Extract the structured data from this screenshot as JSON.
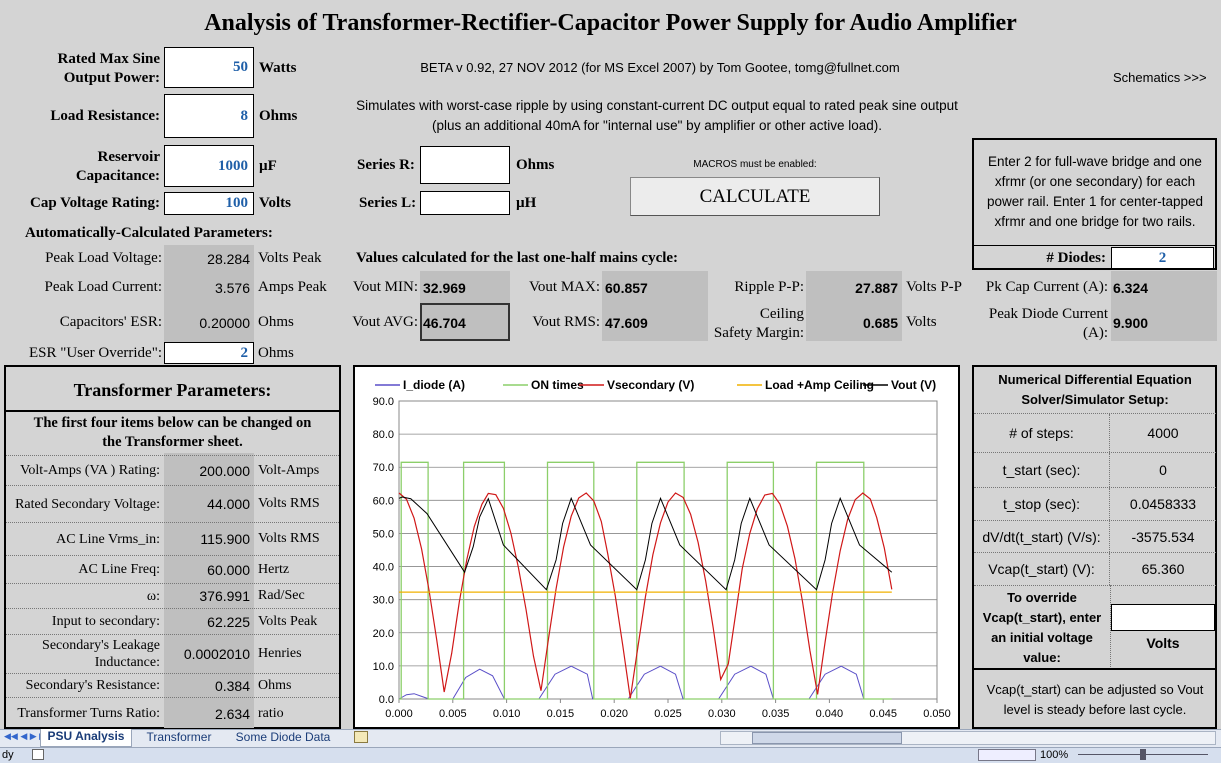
{
  "title": "Analysis of Transformer-Rectifier-Capacitor Power Supply for Audio Amplifier",
  "version": "BETA v 0.92, 27 NOV 2012 (for MS Excel 2007) by Tom Gootee, tomg@fullnet.com",
  "schematics_link": "Schematics >>>",
  "description_line1": "Simulates with worst-case ripple by using constant-current DC output equal to rated peak sine output",
  "description_line2": "(plus an additional 40mA for \"internal use\" by amplifier or other active load).",
  "macros_note": "MACROS must be enabled:",
  "calculate_label": "CALCULATE",
  "inputs": {
    "rated_power_label_1": "Rated Max Sine",
    "rated_power_label_2": "Output Power:",
    "rated_power": "50",
    "rated_power_unit": "Watts",
    "load_resistance_label": "Load Resistance:",
    "load_resistance": "8",
    "load_resistance_unit": "Ohms",
    "reservoir_label_1": "Reservoir",
    "reservoir_label_2": "Capacitance:",
    "reservoir": "1000",
    "reservoir_unit": "µF",
    "cap_voltage_label": "Cap Voltage Rating:",
    "cap_voltage": "100",
    "cap_voltage_unit": "Volts",
    "series_r_label": "Series R:",
    "series_r": "",
    "series_r_unit": "Ohms",
    "series_l_label": "Series L:",
    "series_l": "",
    "series_l_unit": "µH"
  },
  "auto": {
    "heading": "Automatically-Calculated Parameters:",
    "peak_load_voltage_label": "Peak Load Voltage:",
    "peak_load_voltage": "28.284",
    "peak_load_voltage_unit": "Volts Peak",
    "peak_load_current_label": "Peak Load Current:",
    "peak_load_current": "3.576",
    "peak_load_current_unit": "Amps Peak",
    "esr_label": "Capacitors' ESR:",
    "esr": "0.20000",
    "esr_unit": "Ohms",
    "esr_override_label": "ESR \"User Override\":",
    "esr_override": "2",
    "esr_override_unit": "Ohms"
  },
  "cycle": {
    "heading": "Values calculated for the last one-half mains cycle:",
    "vout_min_label": "Vout MIN:",
    "vout_min": "32.969",
    "vout_max_label": "Vout MAX:",
    "vout_max": "60.857",
    "ripple_label": "Ripple P-P:",
    "ripple": "27.887",
    "ripple_unit": "Volts P-P",
    "vout_avg_label": "Vout AVG:",
    "vout_avg": "46.704",
    "vout_rms_label": "Vout RMS:",
    "vout_rms": "47.609",
    "ceiling_label_1": "Ceiling",
    "ceiling_label_2": "Safety Margin:",
    "ceiling": "0.685",
    "ceiling_unit": "Volts",
    "pk_cap_label": "Pk Cap Current (A):",
    "pk_cap": "6.324",
    "peak_diode_label_1": "Peak Diode Current",
    "peak_diode_label_2": "(A):",
    "peak_diode": "9.900"
  },
  "diodes": {
    "note_1": "Enter 2 for full-wave bridge and one",
    "note_2": "xfrmr (or one secondary) for each",
    "note_3": "power rail. Enter 1 for center-tapped",
    "note_4": "xfrmr and one bridge for two rails.",
    "label": "# Diodes:",
    "value": "2"
  },
  "transformer": {
    "heading": "Transformer Parameters:",
    "note_1": "The first four items below can be changed  on",
    "note_2": "the Transformer sheet.",
    "rows": [
      {
        "label": "Volt-Amps (VA ) Rating:",
        "value": "200.000",
        "unit": "Volt-Amps"
      },
      {
        "label": "Rated Secondary Voltage:",
        "value": "44.000",
        "unit": "Volts RMS"
      },
      {
        "label": "AC Line Vrms_in:",
        "value": "115.900",
        "unit": "Volts RMS"
      },
      {
        "label": "AC Line Freq:",
        "value": "60.000",
        "unit": "Hertz"
      },
      {
        "label": "ω:",
        "value": "376.991",
        "unit": "Rad/Sec"
      },
      {
        "label": "Input to secondary:",
        "value": "62.225",
        "unit": "Volts Peak"
      },
      {
        "label": "Secondary's Leakage Inductance:",
        "value": "0.0002010",
        "unit": "Henries"
      },
      {
        "label": "Secondary's Resistance:",
        "value": "0.384",
        "unit": "Ohms"
      },
      {
        "label": "Transformer Turns Ratio:",
        "value": "2.634",
        "unit": "ratio"
      }
    ]
  },
  "solver": {
    "heading_1": "Numerical Differential Equation",
    "heading_2": "Solver/Simulator Setup:",
    "rows": [
      {
        "label": "# of steps:",
        "value": "4000"
      },
      {
        "label": "t_start (sec):",
        "value": "0"
      },
      {
        "label": "t_stop (sec):",
        "value": "0.0458333"
      },
      {
        "label": "dV/dt(t_start) (V/s):",
        "value": "-3575.534"
      },
      {
        "label": "Vcap(t_start) (V):",
        "value": "65.360"
      }
    ],
    "override_1": "To override",
    "override_2": "Vcap(t_start), enter",
    "override_3": "an initial voltage",
    "override_4": "value:",
    "override_value": "",
    "override_unit": "Volts",
    "note_1": "Vcap(t_start) can be adjusted so Vout",
    "note_2": "level is steady before last cycle."
  },
  "tabs": [
    "PSU Analysis",
    "Transformer",
    "Some Diode Data"
  ],
  "status": {
    "ready": "dy",
    "zoom": "100%"
  },
  "colors": {
    "i_diode": "#5a4fc8",
    "on_times": "#8ccf6a",
    "vsecondary": "#d01818",
    "ceiling": "#f0b000",
    "vout": "#000000",
    "input_text": "#1f5fa8"
  },
  "chart_data": {
    "type": "line",
    "xlim": [
      0,
      0.05
    ],
    "ylim": [
      0,
      90
    ],
    "x_ticks": [
      "0.000",
      "0.005",
      "0.010",
      "0.015",
      "0.020",
      "0.025",
      "0.030",
      "0.035",
      "0.040",
      "0.045",
      "0.050"
    ],
    "y_ticks": [
      "0.0",
      "10.0",
      "20.0",
      "30.0",
      "40.0",
      "50.0",
      "60.0",
      "70.0",
      "80.0",
      "90.0"
    ],
    "grid": true,
    "legend": "top",
    "series": [
      {
        "name": "I_diode (A)",
        "x": [
          0,
          0.0007,
          0.0014,
          0.0021,
          0.0028,
          0.0035,
          0.0042,
          0.005,
          0.0062,
          0.0075,
          0.0087,
          0.0098,
          0.0104,
          0.013,
          0.0145,
          0.016,
          0.0175,
          0.018,
          0.0213,
          0.0228,
          0.0243,
          0.0257,
          0.0264,
          0.0297,
          0.0312,
          0.0327,
          0.0341,
          0.0348,
          0.0381,
          0.0396,
          0.0411,
          0.0425,
          0.0432
        ],
        "y": [
          0,
          1.3,
          1.6,
          0.8,
          0,
          0,
          0,
          0,
          6.5,
          9,
          7,
          0,
          0,
          0,
          7.5,
          9.9,
          7.5,
          0,
          0,
          7.5,
          9.9,
          7.5,
          0,
          0,
          7.5,
          9.9,
          7.5,
          0,
          0,
          7.5,
          9.9,
          7.5,
          0
        ]
      },
      {
        "name": "ON times",
        "x": [
          0,
          0.0002,
          0.0002,
          0.0027,
          0.0027,
          0.006,
          0.006,
          0.0098,
          0.0098,
          0.0138,
          0.0138,
          0.0181,
          0.0181,
          0.0221,
          0.0221,
          0.0265,
          0.0265,
          0.0305,
          0.0305,
          0.0348,
          0.0348,
          0.0388,
          0.0388,
          0.0432,
          0.0432,
          0.0458
        ],
        "y": [
          0,
          0,
          71.5,
          71.5,
          0,
          0,
          71.5,
          71.5,
          0,
          0,
          71.5,
          71.5,
          0,
          0,
          71.5,
          71.5,
          0,
          0,
          71.5,
          71.5,
          0,
          0,
          71.5,
          71.5,
          0,
          0
        ]
      },
      {
        "name": "Vsecondary (V)",
        "x": [
          0,
          0.0007,
          0.0014,
          0.0021,
          0.0028,
          0.0035,
          0.0042,
          0.0049,
          0.0056,
          0.0063,
          0.007,
          0.0077,
          0.0083,
          0.009,
          0.0097,
          0.0104,
          0.0111,
          0.0118,
          0.0125,
          0.0132,
          0.0139,
          0.0146,
          0.0153,
          0.016,
          0.0167,
          0.0174,
          0.0181,
          0.0188,
          0.0194,
          0.0201,
          0.0208,
          0.0215,
          0.0222,
          0.0229,
          0.0236,
          0.0243,
          0.025,
          0.0257,
          0.0264,
          0.0271,
          0.0278,
          0.0285,
          0.0292,
          0.0299,
          0.0306,
          0.0313,
          0.0319,
          0.0326,
          0.0333,
          0.034,
          0.0347,
          0.0354,
          0.0361,
          0.0368,
          0.0375,
          0.0382,
          0.0389,
          0.0396,
          0.0403,
          0.041,
          0.0417,
          0.0424,
          0.0431,
          0.0438,
          0.0444,
          0.0451,
          0.0458
        ],
        "y": [
          62.2,
          60.3,
          54.6,
          45.3,
          32.7,
          17.9,
          2.1,
          13.8,
          29.3,
          42.1,
          52.1,
          58.8,
          62.1,
          61.7,
          57.6,
          50.1,
          39.7,
          27.1,
          12.9,
          2.5,
          18.4,
          33.3,
          45.9,
          55.2,
          60.7,
          62.2,
          59.8,
          53.6,
          43.9,
          31.1,
          16.1,
          0.2,
          15.7,
          30.8,
          43.6,
          53.2,
          59.5,
          62.2,
          60.9,
          55.8,
          47.3,
          35.6,
          21.5,
          5.9,
          10.6,
          26.0,
          39.3,
          50.0,
          57.4,
          61.6,
          62.1,
          58.9,
          52.2,
          42.3,
          29.4,
          14.5,
          1.4,
          17.2,
          32.1,
          44.8,
          54.3,
          60.2,
          62.2,
          60.4,
          54.8,
          45.6,
          33.1
        ]
      },
      {
        "name": "Load +Amp Ceiling",
        "x": [
          0,
          0.0458
        ],
        "y": [
          32.3,
          32.3
        ]
      },
      {
        "name": "Vout (V)",
        "x": [
          0,
          0.0003,
          0.0011,
          0.0026,
          0.0061,
          0.0069,
          0.0075,
          0.0083,
          0.0097,
          0.0137,
          0.0146,
          0.0152,
          0.016,
          0.0178,
          0.0221,
          0.0229,
          0.0235,
          0.0243,
          0.0261,
          0.0304,
          0.0312,
          0.0318,
          0.0326,
          0.0344,
          0.0388,
          0.0396,
          0.0402,
          0.041,
          0.0428,
          0.0458
        ],
        "y": [
          60.6,
          61.0,
          60.5,
          56.0,
          38.3,
          46.0,
          55.0,
          60.5,
          46.5,
          33.0,
          42.0,
          53.0,
          60.6,
          46.5,
          33.0,
          42.0,
          53.0,
          60.6,
          46.5,
          33.0,
          42.0,
          53.0,
          60.6,
          46.5,
          33.0,
          42.0,
          53.0,
          60.6,
          46.5,
          38.3
        ]
      }
    ]
  }
}
